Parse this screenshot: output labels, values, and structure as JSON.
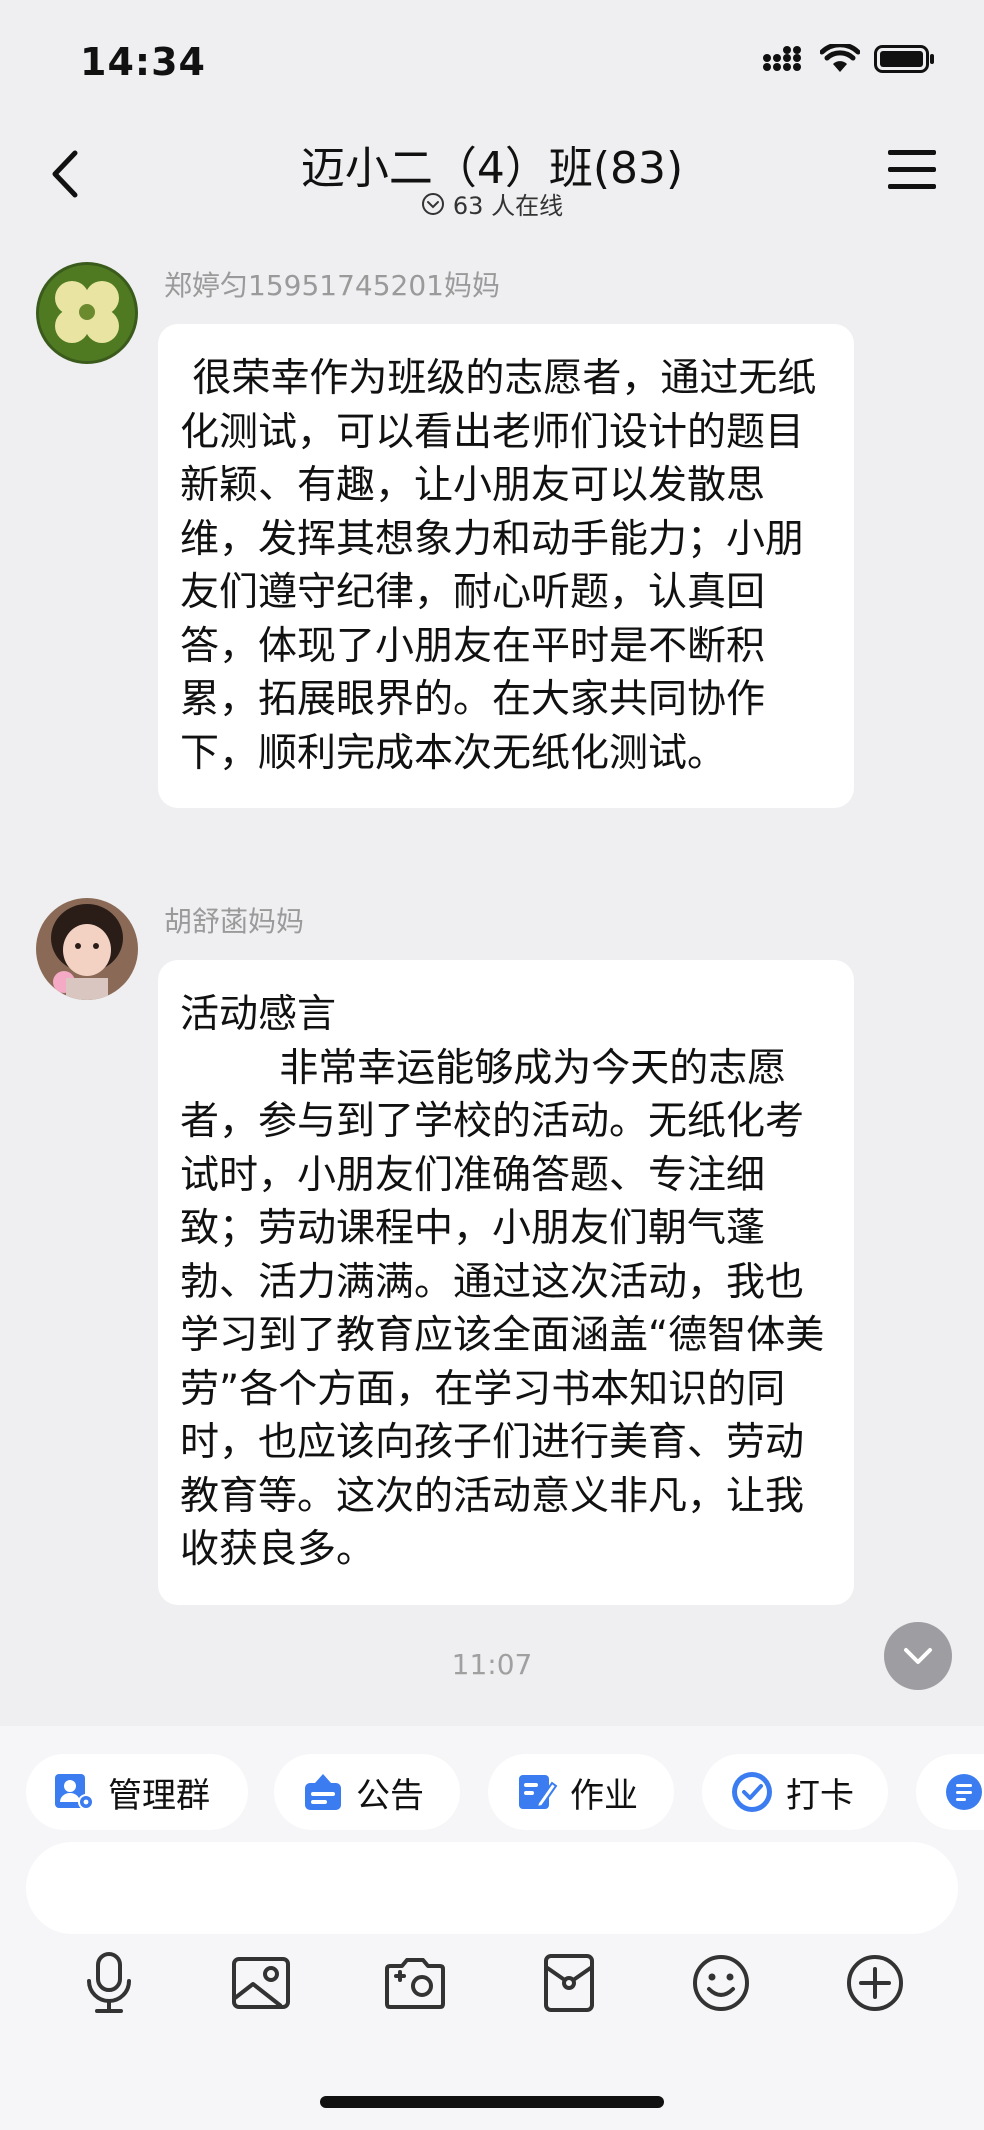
{
  "status_bar": {
    "time": "14:34"
  },
  "header": {
    "title": "迈小二（4）班(83)",
    "online": "63 人在线"
  },
  "messages": [
    {
      "sender": "郑婷匀15951745201妈妈",
      "text": " 很荣幸作为班级的志愿者，通过无纸化测试，可以看出老师们设计的题目新颖、有趣，让小朋友可以发散思维，发挥其想象力和动手能力；小朋友们遵守纪律，耐心听题，认真回答，体现了小朋友在平时是不断积累，拓展眼界的。在大家共同协作下，顺利完成本次无纸化测试。"
    },
    {
      "sender": "胡舒菡妈妈",
      "text": "活动感言\n        非常幸运能够成为今天的志愿者，参与到了学校的活动。无纸化考试时，小朋友们准确答题、专注细致；劳动课程中，小朋友们朝气蓬勃、活力满满。通过这次活动，我也学习到了教育应该全面涵盖“德智体美劳”各个方面，在学习书本知识的同时，也应该向孩子们进行美育、劳动教育等。这次的活动意义非凡，让我收获良多。"
    }
  ],
  "timestamp": "11:07",
  "quick_actions": [
    {
      "label": "管理群",
      "icon": "manage-group-icon"
    },
    {
      "label": "公告",
      "icon": "announcement-icon"
    },
    {
      "label": "作业",
      "icon": "homework-icon"
    },
    {
      "label": "打卡",
      "icon": "check-in-icon"
    },
    {
      "label": "",
      "icon": "teacher-icon"
    }
  ],
  "toolbar": [
    "microphone-icon",
    "image-icon",
    "camera-icon",
    "red-envelope-icon",
    "emoji-icon",
    "plus-icon"
  ],
  "colors": {
    "accent": "#3b7cf0",
    "background": "#efeff1",
    "bubble": "#ffffff"
  }
}
